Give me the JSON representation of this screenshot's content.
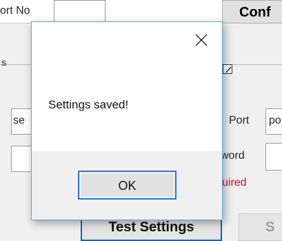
{
  "background_window": {
    "port_no_label": "ort No",
    "config_button_partial": "Conf",
    "left_fragment": "s",
    "field_fragment": "se",
    "port_label": "Port",
    "port_value_partial": "po",
    "password_label_partial": "word",
    "required_partial": "uired",
    "test_settings_button": "Test Settings",
    "right_button_partial": "S"
  },
  "dialog": {
    "message": "Settings saved!",
    "ok_button": "OK",
    "close_icon": "close-icon",
    "accent_color": "#2b78d4"
  }
}
